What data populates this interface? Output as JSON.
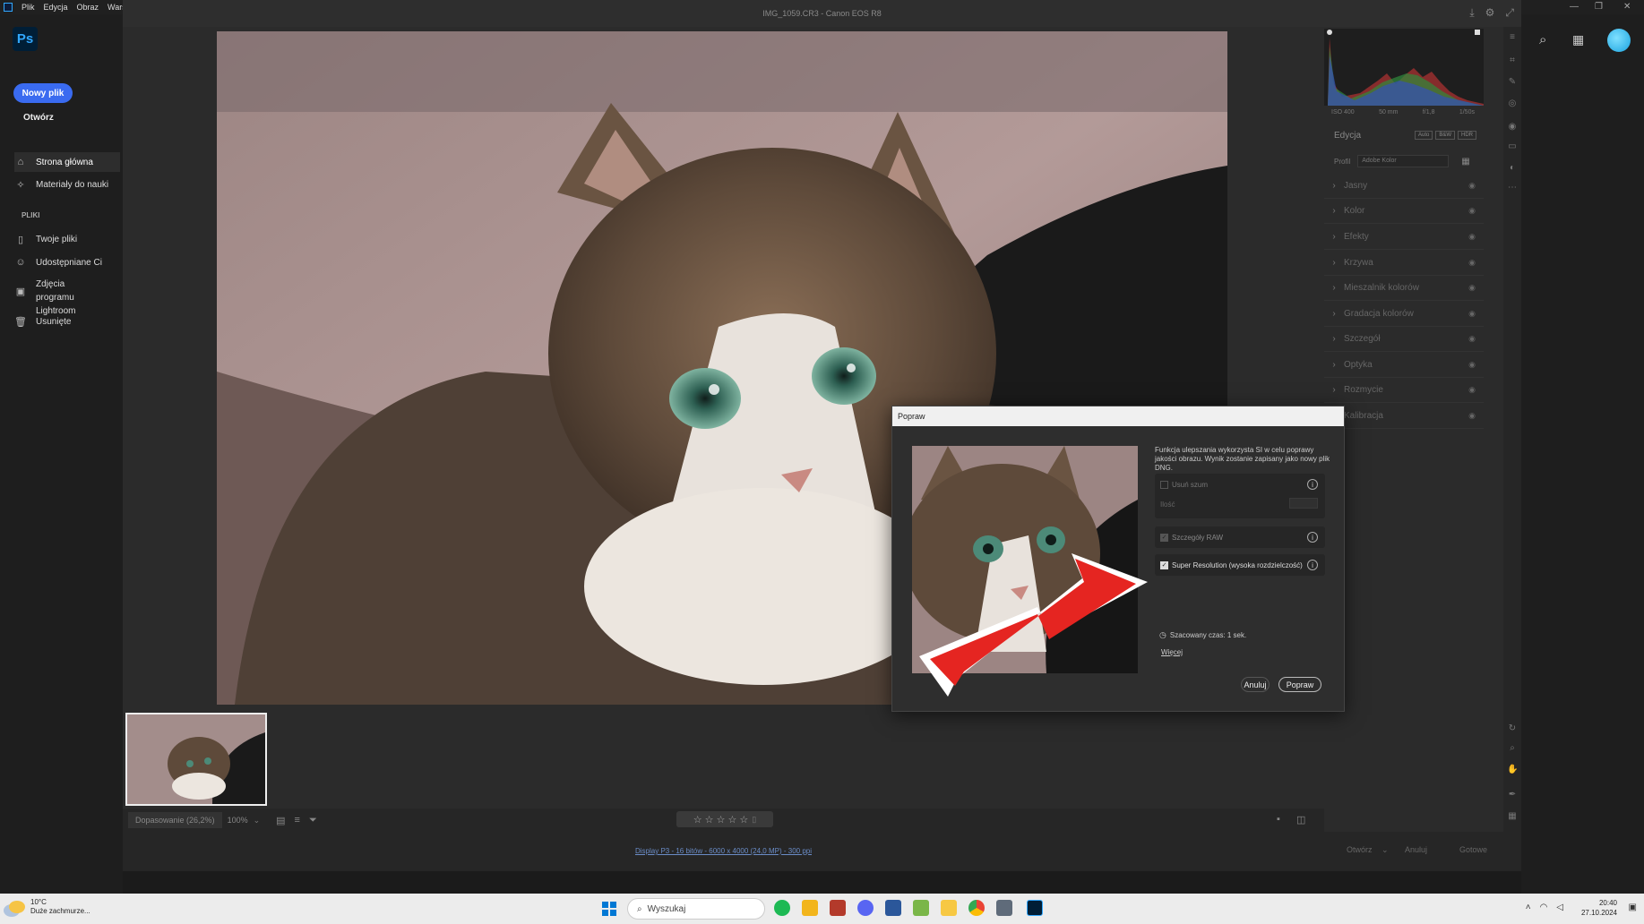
{
  "menu": [
    "Plik",
    "Edycja",
    "Obraz",
    "Warstw"
  ],
  "ps_home": {
    "logo": "Ps",
    "new_file": "Nowy plik",
    "open": "Otwórz",
    "nav": [
      "Strona główna",
      "Materiały do nauki"
    ],
    "files_heading": "PLIKI",
    "files": [
      "Twoje pliki",
      "Udostępniane Ci",
      "Zdjęcia programu Lightroom",
      "Usunięte"
    ]
  },
  "acr": {
    "title": "IMG_1059.CR3  -  Canon EOS R8",
    "zoom_fit": "Dopasowanie (26,2%)",
    "zoom_pct": "100%",
    "stars": "☆ ☆ ☆ ☆ ☆",
    "file_info": "Display P3 - 16 bitów - 6000 x 4000 (24,0 MP) - 300 ppi",
    "footer_buttons": {
      "open": "Otwórz",
      "cancel": "Anuluj",
      "done": "Gotowe"
    },
    "histogram_info": [
      "ISO 400",
      "50 mm",
      "f/1,8",
      "1/50s"
    ],
    "edit_title": "Edycja",
    "edit_buttons": [
      "Auto",
      "B&W",
      "HDR"
    ],
    "profile_label": "Profil",
    "profile_value": "Adobe Kolor",
    "sections": [
      "Jasny",
      "Kolor",
      "Efekty",
      "Krzywa",
      "Mieszalnik kolorów",
      "Gradacja kolorów",
      "Szczegół",
      "Optyka",
      "Rozmycie",
      "Kalibracja"
    ]
  },
  "dialog": {
    "title": "Popraw",
    "description": "Funkcja ulepszania wykorzysta SI w celu poprawy jakości obrazu. Wynik zostanie zapisany jako nowy plik DNG.",
    "denoise_label": "Usuń szum",
    "amount_label": "Ilość",
    "raw_details_label": "Szczegóły RAW",
    "super_res_label": "Super Resolution (wysoka rozdzielczość)",
    "estimate": "Szacowany czas: 1 sek.",
    "more": "Więcej",
    "cancel": "Anuluj",
    "apply": "Popraw"
  },
  "taskbar": {
    "temp": "10°C",
    "weather": "Duże zachmurze...",
    "search": "Wyszukaj",
    "time": "20:40",
    "date": "27.10.2024"
  },
  "colors": {
    "accent": "#3a6bf0",
    "arrow": "#e52521"
  }
}
